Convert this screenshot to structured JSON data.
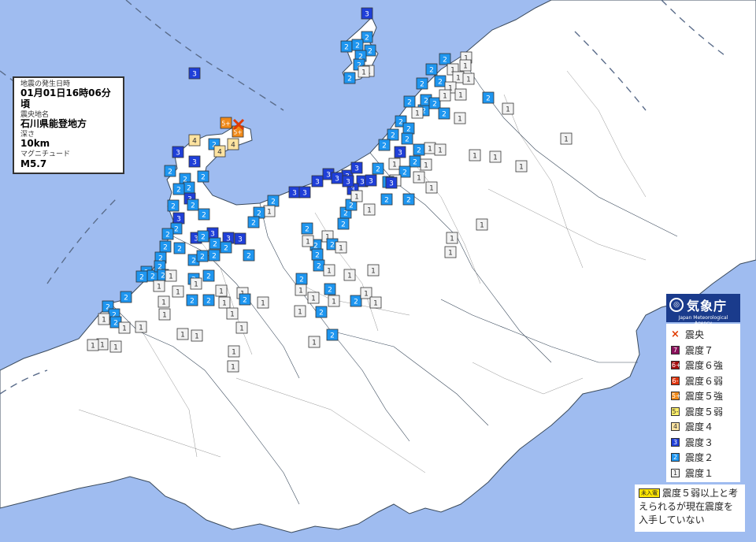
{
  "info": {
    "time_label": "地震の発生日時",
    "time_value": "01月01日16時06分頃",
    "epicenter_label": "震央地名",
    "epicenter_value": "石川県能登地方",
    "depth_label": "深さ",
    "depth_value": "10km",
    "magnitude_label": "マグニチュード",
    "magnitude_value": "M5.7"
  },
  "agency": {
    "name": "気象庁",
    "name_en": "Japan Meteorological Agency"
  },
  "legend": {
    "items": [
      {
        "symbol": "×",
        "label": "震央",
        "color": "#e03a00",
        "text_color": "#e03a00",
        "kind": "x"
      },
      {
        "symbol": "7",
        "label": "震度７",
        "color": "#8a0f5a",
        "text_color": "#ffffff",
        "kind": "box"
      },
      {
        "symbol": "6+",
        "label": "震度６強",
        "color": "#a50d0d",
        "text_color": "#ffffff",
        "kind": "box"
      },
      {
        "symbol": "6-",
        "label": "震度６弱",
        "color": "#e0330c",
        "text_color": "#ffffff",
        "kind": "box"
      },
      {
        "symbol": "5+",
        "label": "震度５強",
        "color": "#f08a1a",
        "text_color": "#ffffff",
        "kind": "box"
      },
      {
        "symbol": "5-",
        "label": "震度５弱",
        "color": "#fff06a",
        "text_color": "#333333",
        "kind": "box"
      },
      {
        "symbol": "4",
        "label": "震度４",
        "color": "#fde3a0",
        "text_color": "#333333",
        "kind": "box"
      },
      {
        "symbol": "3",
        "label": "震度３",
        "color": "#1f3fd8",
        "text_color": "#ffffff",
        "kind": "box"
      },
      {
        "symbol": "2",
        "label": "震度２",
        "color": "#1e96f0",
        "text_color": "#ffffff",
        "kind": "box"
      },
      {
        "symbol": "1",
        "label": "震度１",
        "color": "#f2f2f2",
        "text_color": "#333333",
        "kind": "box"
      }
    ]
  },
  "note": {
    "badge": "未入電",
    "text": "震度５弱以上と考えられるが現在震度を入手していない"
  },
  "colors": {
    "sea": "#9fbcf0",
    "land": "#ffffff",
    "i1": "#f2f2f2",
    "i2": "#1e96f0",
    "i3": "#1f3fd8",
    "i4": "#fde3a0",
    "i5m": "#f08a1a"
  }
}
